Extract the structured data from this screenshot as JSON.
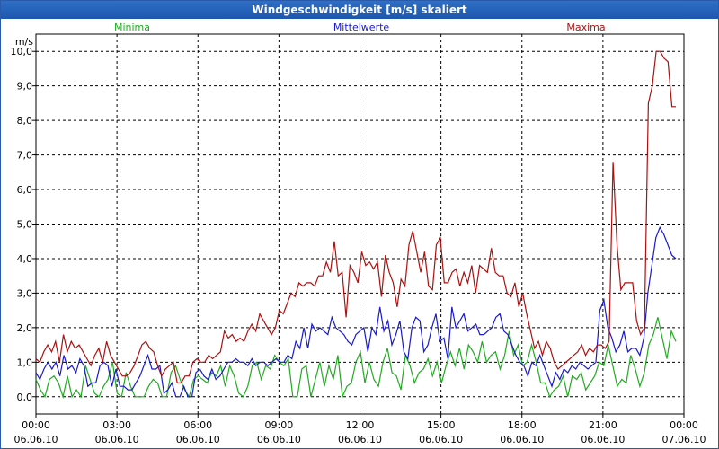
{
  "title": "Windgeschwindigkeit [m/s] skaliert",
  "colors": {
    "min": "#22aa22",
    "mean": "#1a1acc",
    "max": "#aa1111",
    "title_bg": "#2360b8"
  },
  "chart_data": {
    "type": "line",
    "title": "Windgeschwindigkeit [m/s] skaliert",
    "ylabel": "m/s",
    "ylim": [
      -0.5,
      10.5
    ],
    "y_ticks": [
      "0,0",
      "1,0",
      "2,0",
      "3,0",
      "4,0",
      "5,0",
      "6,0",
      "7,0",
      "8,0",
      "9,0",
      "10,0"
    ],
    "x_range_hours": [
      0,
      24
    ],
    "x_ticks": [
      {
        "time": "00:00",
        "date": "06.06.10"
      },
      {
        "time": "03:00",
        "date": "06.06.10"
      },
      {
        "time": "06:00",
        "date": "06.06.10"
      },
      {
        "time": "09:00",
        "date": "06.06.10"
      },
      {
        "time": "12:00",
        "date": "06.06.10"
      },
      {
        "time": "15:00",
        "date": "06.06.10"
      },
      {
        "time": "18:00",
        "date": "06.06.10"
      },
      {
        "time": "21:00",
        "date": "06.06.10"
      },
      {
        "time": "00:00",
        "date": "07.06.10"
      }
    ],
    "grid": true,
    "legend_position": "top",
    "series": [
      {
        "name": "Minima",
        "color": "#22aa22",
        "values": [
          0.5,
          0.2,
          0.0,
          0.5,
          0.6,
          0.4,
          0.0,
          0.6,
          0.0,
          0.2,
          0.0,
          0.9,
          0.5,
          0.1,
          0.0,
          0.3,
          0.5,
          1.0,
          0.1,
          0.0,
          0.7,
          0.3,
          0.0,
          0.0,
          0.0,
          0.3,
          0.5,
          0.4,
          0.0,
          0.0,
          0.7,
          0.9,
          0.5,
          0.2,
          0.0,
          0.5,
          0.6,
          0.5,
          0.4,
          0.7,
          0.6,
          0.9,
          0.3,
          0.9,
          0.6,
          0.1,
          0.0,
          0.3,
          0.9,
          1.0,
          0.5,
          0.9,
          0.8,
          1.2,
          1.0,
          0.9,
          1.1,
          0.0,
          0.0,
          0.8,
          0.9,
          0.0,
          0.5,
          1.0,
          0.3,
          0.9,
          0.5,
          1.2,
          0.0,
          0.3,
          0.4,
          1.0,
          1.3,
          0.4,
          1.0,
          0.5,
          0.3,
          1.0,
          1.4,
          0.7,
          0.6,
          0.2,
          1.2,
          0.9,
          0.4,
          0.7,
          0.8,
          1.1,
          0.6,
          1.0,
          0.4,
          0.9,
          1.3,
          0.9,
          1.4,
          0.8,
          1.5,
          1.3,
          1.0,
          1.6,
          1.0,
          1.2,
          1.3,
          0.8,
          1.2,
          1.9,
          1.2,
          1.5,
          0.9,
          1.0,
          1.5,
          1.0,
          0.4,
          0.4,
          0.0,
          0.2,
          0.3,
          0.6,
          0.0,
          0.6,
          0.5,
          0.7,
          0.2,
          0.4,
          0.6,
          1.0,
          0.9,
          1.5,
          0.9,
          0.3,
          0.5,
          0.4,
          1.2,
          0.8,
          0.3,
          0.7,
          1.5,
          1.8,
          2.3,
          1.7,
          1.1,
          1.9,
          1.6
        ]
      },
      {
        "name": "Mittelwerte",
        "color": "#1a1acc",
        "values": [
          0.7,
          0.5,
          0.8,
          1.0,
          0.8,
          1.0,
          0.6,
          1.2,
          0.8,
          0.9,
          0.7,
          1.1,
          0.9,
          0.3,
          0.4,
          0.4,
          0.9,
          1.0,
          0.9,
          0.3,
          0.8,
          0.3,
          0.3,
          0.2,
          0.2,
          0.4,
          0.6,
          0.9,
          1.2,
          0.8,
          0.8,
          0.9,
          0.1,
          0.2,
          0.4,
          0.0,
          0.0,
          0.3,
          0.0,
          0.0,
          0.7,
          0.8,
          0.6,
          0.5,
          0.8,
          0.5,
          0.6,
          0.8,
          1.0,
          1.0,
          1.1,
          1.0,
          1.0,
          0.9,
          1.1,
          0.9,
          1.0,
          1.0,
          0.9,
          1.0,
          1.1,
          1.0,
          1.0,
          1.2,
          1.1,
          1.6,
          1.4,
          2.0,
          1.4,
          2.1,
          1.9,
          2.0,
          1.9,
          1.8,
          2.3,
          2.0,
          1.9,
          1.8,
          1.6,
          1.5,
          1.8,
          1.9,
          2.0,
          1.3,
          2.0,
          1.8,
          2.6,
          1.9,
          2.2,
          1.5,
          1.8,
          2.2,
          1.3,
          1.1,
          2.0,
          2.3,
          2.2,
          1.3,
          1.5,
          2.0,
          2.4,
          1.6,
          1.7,
          1.1,
          2.6,
          2.0,
          2.2,
          2.4,
          1.9,
          2.0,
          2.1,
          1.8,
          1.8,
          1.9,
          2.0,
          2.3,
          2.4,
          1.9,
          1.8,
          1.5,
          1.2,
          1.0,
          0.9,
          0.6,
          1.0,
          0.9,
          1.2,
          0.9,
          0.6,
          0.3,
          0.7,
          0.5,
          0.8,
          0.7,
          0.9,
          0.8,
          1.0,
          0.9,
          0.8,
          0.9,
          1.0,
          2.5,
          2.8,
          2.0,
          1.7,
          1.3,
          1.5,
          1.9,
          1.3,
          1.4,
          1.4,
          1.2,
          1.7,
          3.0,
          3.8,
          4.6,
          4.9,
          4.7,
          4.4,
          4.1,
          4.0
        ]
      },
      {
        "name": "Maxima",
        "color": "#aa1111",
        "values": [
          1.1,
          1.0,
          1.3,
          1.5,
          1.3,
          1.6,
          1.0,
          1.8,
          1.3,
          1.6,
          1.4,
          1.5,
          1.3,
          1.1,
          0.9,
          1.2,
          1.4,
          1.0,
          1.6,
          1.2,
          1.0,
          0.8,
          0.6,
          0.6,
          0.7,
          0.9,
          1.2,
          1.5,
          1.6,
          1.4,
          1.3,
          0.9,
          0.6,
          0.8,
          0.9,
          1.0,
          0.4,
          0.4,
          0.6,
          0.6,
          1.0,
          1.1,
          1.0,
          1.0,
          1.2,
          1.1,
          1.2,
          1.3,
          1.9,
          1.7,
          1.8,
          1.6,
          1.7,
          1.6,
          1.9,
          2.1,
          1.9,
          2.4,
          2.2,
          2.0,
          1.8,
          2.0,
          2.5,
          2.4,
          2.7,
          3.0,
          2.9,
          3.3,
          3.2,
          3.3,
          3.3,
          3.2,
          3.5,
          3.5,
          3.9,
          3.6,
          4.5,
          3.5,
          3.6,
          2.3,
          3.8,
          3.6,
          3.3,
          4.2,
          3.8,
          3.9,
          3.7,
          3.9,
          2.9,
          4.1,
          3.6,
          3.3,
          2.6,
          3.4,
          3.2,
          4.4,
          4.8,
          4.2,
          3.6,
          4.2,
          3.2,
          3.1,
          4.4,
          4.6,
          3.3,
          3.3,
          3.6,
          3.7,
          3.2,
          3.6,
          3.3,
          3.8,
          3.0,
          3.8,
          3.7,
          3.6,
          4.3,
          3.6,
          3.5,
          3.5,
          3.0,
          2.9,
          3.3,
          2.6,
          3.0,
          2.4,
          1.9,
          1.4,
          1.6,
          1.2,
          1.6,
          1.4,
          1.0,
          0.8,
          0.9,
          1.0,
          1.1,
          1.2,
          1.3,
          1.5,
          1.2,
          1.4,
          1.3,
          1.5,
          1.5,
          1.4,
          1.6,
          6.8,
          4.4,
          3.1,
          3.3,
          3.3,
          3.3,
          2.2,
          1.8,
          2.0,
          8.5,
          9.0,
          10.0,
          10.0,
          9.8,
          9.7,
          8.4,
          8.4
        ]
      }
    ]
  }
}
